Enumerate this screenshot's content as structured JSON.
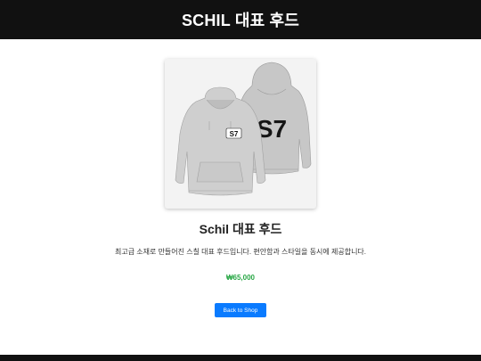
{
  "header": {
    "title": "SCHIL 대표 후드"
  },
  "product": {
    "image_icon": "gray-hoodie-front-and-back-photo",
    "front_logo_text": "S7",
    "back_logo_text": "S7",
    "title": "Schil 대표 후드",
    "description": "최고급 소재로 만들어진 스칠 대표 후드입니다. 편안함과 스타일을 동시에 제공합니다.",
    "price": "₩65,000",
    "price_color": "#28a745"
  },
  "actions": {
    "back_label": "Back to Shop",
    "back_color": "#0a7bff"
  },
  "colors": {
    "header_bg": "#111111",
    "footer_bg": "#111111"
  }
}
